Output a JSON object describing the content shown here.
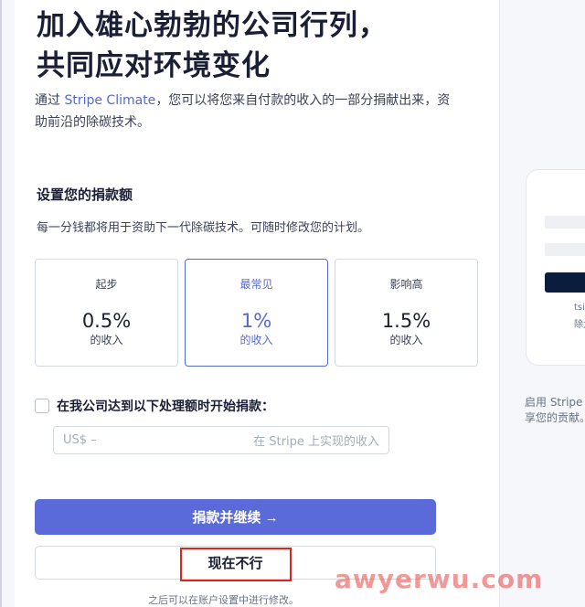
{
  "headline": {
    "line1": "加入雄心勃勃的公司行列，",
    "line2": "共同应对环境变化"
  },
  "intro": {
    "before": "通过 ",
    "link": "Stripe Climate",
    "after": "，您可以将您来自付款的收入的一部分捐献出来，资助前沿的除碳技术。"
  },
  "donation": {
    "title": "设置您的捐款额",
    "description": "每一分钱都将用于资助下一代除碳技术。可随时修改您的计划。",
    "options": [
      {
        "label": "起步",
        "percent": "0.5%",
        "sub": "的收入"
      },
      {
        "label": "最常见",
        "percent": "1%",
        "sub": "的收入"
      },
      {
        "label": "影响高",
        "percent": "1.5%",
        "sub": "的收入"
      }
    ],
    "selected_index": 1
  },
  "threshold": {
    "checkbox_label": "在我公司达到以下处理额时开始捐款：",
    "checked": false,
    "input_prefix": "US$  –",
    "input_suffix": "在 Stripe 上实现的收入"
  },
  "actions": {
    "primary_label": "捐款并继续 →",
    "secondary_label": "现在不行"
  },
  "footnote": "之后可以在账户设置中进行修改。",
  "preview": {
    "text1": "tsin",
    "text2": "除大",
    "caption1": "启用 Stripe",
    "caption2": "享您的贡献。"
  },
  "watermark": "awyerwu.com",
  "colors": {
    "accent": "#5469d4",
    "primary_button": "#5b6ad9",
    "highlight": "#e0231d"
  }
}
